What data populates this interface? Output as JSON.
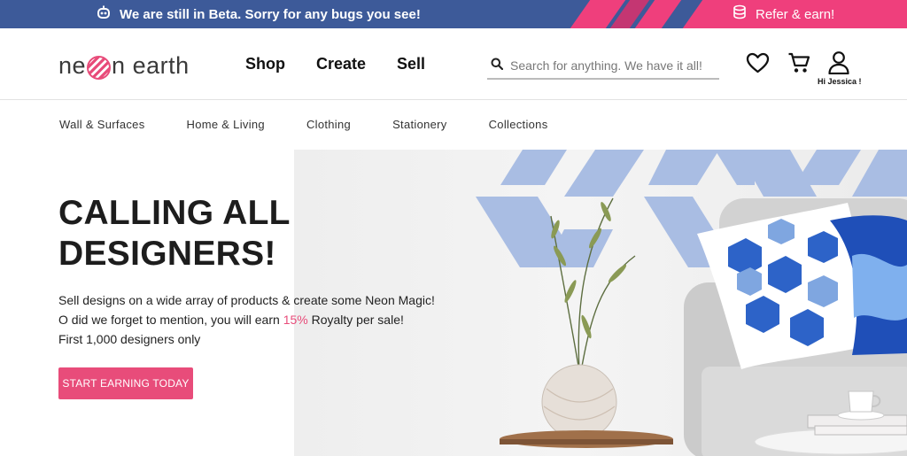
{
  "beta_banner": {
    "message": "We are still in Beta. Sorry for any bugs you see!",
    "refer_label": "Refer & earn!",
    "colors": {
      "background": "#3d5a99",
      "accent": "#ef3f7c"
    }
  },
  "header": {
    "logo_left": "ne",
    "logo_right": "n earth",
    "nav": [
      {
        "label": "Shop"
      },
      {
        "label": "Create"
      },
      {
        "label": "Sell"
      }
    ],
    "search": {
      "placeholder": "Search for anything. We have it all!",
      "value": ""
    },
    "greeting": "Hi Jessica !",
    "icons": [
      "heart-icon",
      "cart-icon",
      "user-icon",
      "search-icon"
    ]
  },
  "categories": [
    {
      "label": "Wall & Surfaces"
    },
    {
      "label": "Home & Living"
    },
    {
      "label": "Clothing"
    },
    {
      "label": "Stationery"
    },
    {
      "label": "Collections"
    }
  ],
  "hero": {
    "title_line1": "CALLING ALL",
    "title_line2": "DESIGNERS!",
    "line1": "Sell designs on a wide array of products & create some Neon Magic!",
    "line2_before": "O did we forget to mention, you will earn ",
    "line2_highlight": "15%",
    "line2_after": " Royalty per sale!",
    "line3": "First 1,000 designers only",
    "cta_label": "START EARNING TODAY",
    "colors": {
      "accent": "#e84c7a",
      "pattern": "#a9bde3"
    }
  }
}
